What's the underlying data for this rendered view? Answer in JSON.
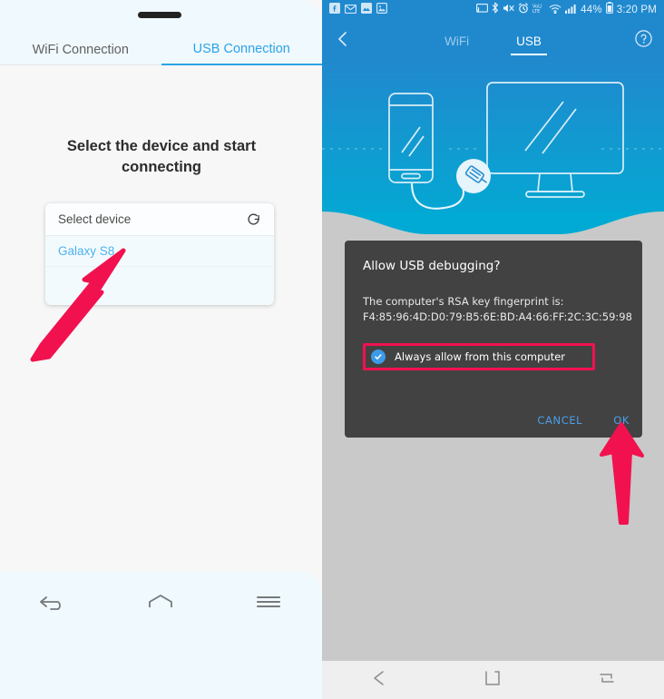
{
  "left_panel": {
    "tabs": [
      {
        "label": "WiFi Connection",
        "active": false
      },
      {
        "label": "USB Connection",
        "active": true
      }
    ],
    "headline": "Select the device and start connecting",
    "device_card": {
      "header_label": "Select device",
      "refresh_icon": "refresh-icon",
      "devices": [
        "Galaxy S8"
      ]
    },
    "nav": [
      {
        "icon": "back-arrow-icon",
        "name": "back"
      },
      {
        "icon": "home-icon",
        "name": "home"
      },
      {
        "icon": "menu-icon",
        "name": "menu"
      }
    ],
    "colors": {
      "accent": "#2aa3e8",
      "device_link": "#4db3ef",
      "background": "#f7f7f7"
    }
  },
  "right_panel": {
    "statusbar": {
      "left_icons": [
        "facebook-icon",
        "email-icon",
        "gallery-icon",
        "photo-icon"
      ],
      "right_icons": [
        "screencast-icon",
        "bluetooth-icon",
        "mute-icon",
        "alarm-icon",
        "volte-icon",
        "wifi-icon",
        "signal-icon"
      ],
      "battery_percent": "44%",
      "battery_icon": "battery-icon",
      "time": "3:20 PM"
    },
    "appbar": {
      "back_icon": "back-chevron-icon",
      "help_icon": "help-circle-icon",
      "tabs": [
        {
          "label": "WiFi",
          "active": false
        },
        {
          "label": "USB",
          "active": true
        }
      ]
    },
    "hero": {
      "phone_icon": "smartphone-icon",
      "monitor_icon": "desktop-monitor-icon",
      "usb_icon": "usb-connector-icon"
    },
    "dialog": {
      "title": "Allow USB debugging?",
      "body_line1": "The computer's RSA key fingerprint is:",
      "body_line2": "F4:85:96:4D:D0:79:B5:6E:BD:A4:66:FF:2C:3C:59:98",
      "checkbox": {
        "label": "Always allow from this computer",
        "checked": true,
        "icon": "checkmark-icon"
      },
      "cancel_label": "CANCEL",
      "ok_label": "OK",
      "colors": {
        "surface": "#424242",
        "action": "#4aa0e8",
        "highlight": "#f2114f"
      }
    },
    "nav": [
      {
        "icon": "back-arrow-icon",
        "name": "back"
      },
      {
        "icon": "home-square-icon",
        "name": "home"
      },
      {
        "icon": "recents-icon",
        "name": "recents"
      }
    ],
    "colors": {
      "appbar": "#2089ce",
      "hero_bottom": "#00aad4",
      "navbar": "#efefef"
    }
  },
  "annotations": {
    "arrow_color": "#f2114f",
    "arrows": [
      {
        "name": "arrow-to-galaxy-s8"
      },
      {
        "name": "arrow-to-ok-button"
      }
    ]
  }
}
